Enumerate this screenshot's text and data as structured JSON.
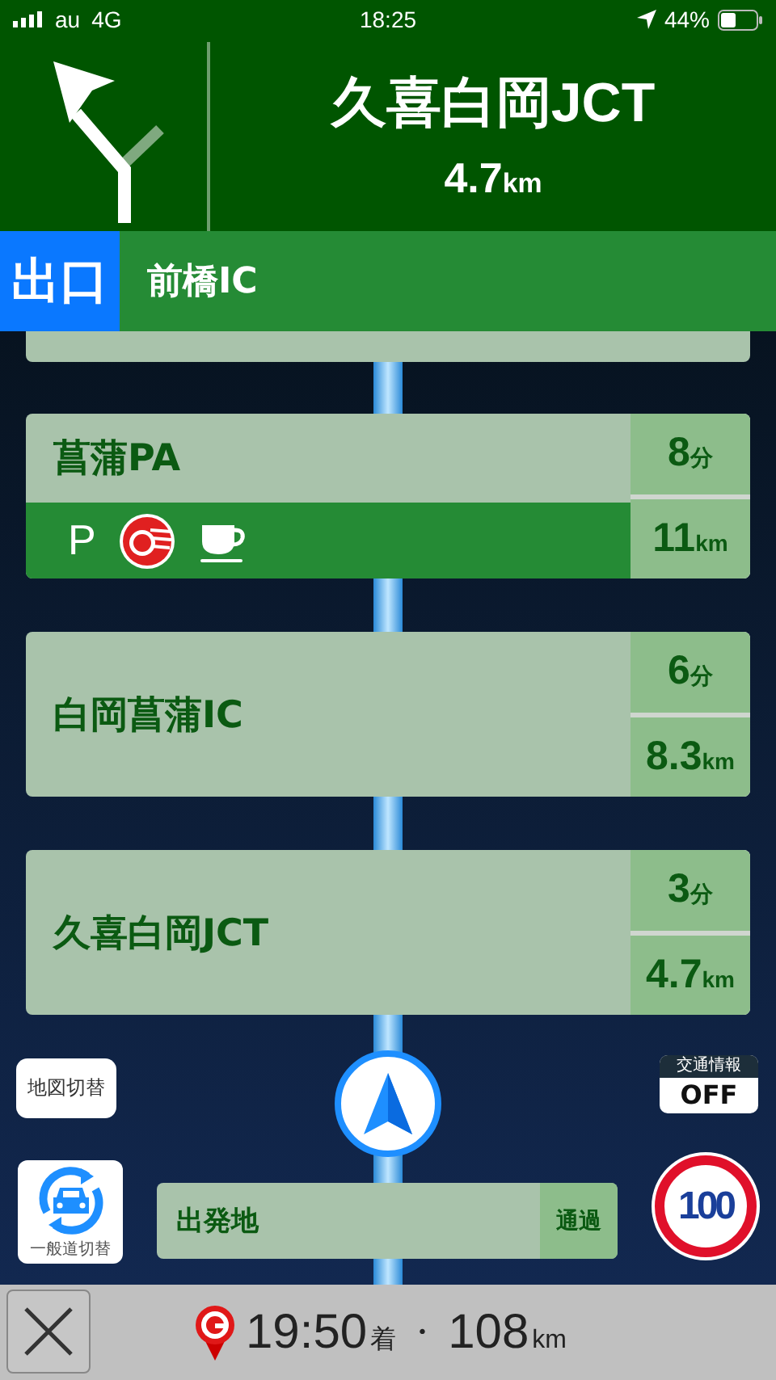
{
  "status_bar": {
    "carrier": "au",
    "network": "4G",
    "time": "18:25",
    "battery": "44%"
  },
  "guidance": {
    "destination": "久喜白岡JCT",
    "distance": "4.7",
    "unit": "km"
  },
  "exit": {
    "badge": "出口",
    "name": "前橋IC"
  },
  "points": [
    {
      "name": "菖蒲PA",
      "time": "8",
      "time_unit": "分",
      "distance": "11",
      "distance_unit": "km",
      "facilities": [
        {
          "kind": "parking",
          "label": "P"
        },
        {
          "kind": "fuel"
        },
        {
          "kind": "cafe"
        }
      ]
    },
    {
      "name": "白岡菖蒲IC",
      "time": "6",
      "time_unit": "分",
      "distance": "8.3",
      "distance_unit": "km"
    },
    {
      "name": "久喜白岡JCT",
      "time": "3",
      "time_unit": "分",
      "distance": "4.7",
      "distance_unit": "km"
    }
  ],
  "map_switch": "地図切替",
  "traffic": {
    "label": "交通情報",
    "value": "OFF"
  },
  "road_switch": "一般道切替",
  "start": {
    "name": "出発地",
    "status": "通過"
  },
  "speed_limit": "100",
  "arrival": {
    "time": "19:50",
    "suffix": "着",
    "separator": "・",
    "distance": "108",
    "unit": "km"
  }
}
